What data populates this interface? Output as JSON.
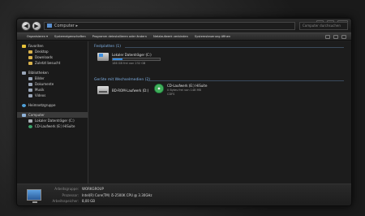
{
  "address": {
    "path": "Computer ▸"
  },
  "search": {
    "placeholder": "Computer durchsuchen"
  },
  "toolbar": {
    "items": [
      "Organisieren ▾",
      "Systemeigenschaften",
      "Programm deinstallieren oder ändern",
      "Netzlaufwerk verbinden",
      "Systemsteuerung öffnen"
    ]
  },
  "nav": {
    "favorites": {
      "label": "Favoriten",
      "items": [
        "Desktop",
        "Downloads",
        "Zuletzt besucht"
      ]
    },
    "libraries": {
      "label": "Bibliotheken",
      "items": [
        "Bilder",
        "Dokumente",
        "Musik",
        "Videos"
      ]
    },
    "homegroup": {
      "label": "Heimnetzgruppe"
    },
    "computer": {
      "label": "Computer",
      "items": [
        "Lokaler Datenträger (C:)",
        "CD-Laufwerk (E:) HiSuite"
      ]
    }
  },
  "content": {
    "hdd_section": "Festplatten (1)",
    "hdd": {
      "name": "Lokaler Datenträger (C:)",
      "free": "186 GB frei von 232 GB",
      "used_fraction": 0.2
    },
    "removable_section": "Geräte mit Wechselmedien (2)",
    "bd": {
      "name": "BD-ROM-Laufwerk (D:)"
    },
    "cd": {
      "name": "CD-Laufwerk (E:) HiSuite",
      "free": "0 Bytes frei von 148 MB",
      "fs": "CDFS"
    }
  },
  "details": {
    "workgroup_label": "Arbeitsgruppe:",
    "workgroup": "WORKGROUP",
    "processor_label": "Prozessor:",
    "processor": "Intel(R) Core(TM) i5-2500K CPU @ 3.30GHz",
    "memory_label": "Arbeitsspeicher:",
    "memory": "8,00 GB"
  }
}
